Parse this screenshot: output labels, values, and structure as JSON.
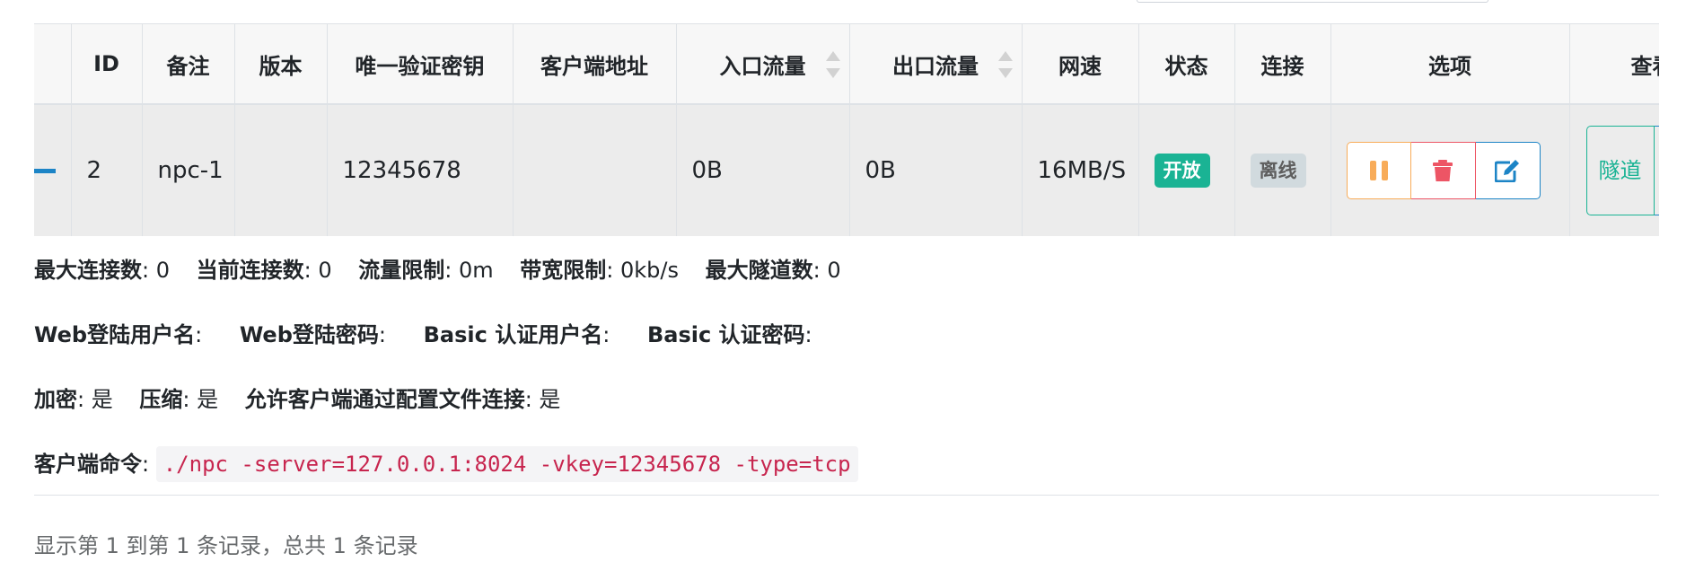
{
  "table": {
    "headers": {
      "id": "ID",
      "remark": "备注",
      "version": "版本",
      "vkey": "唯一验证密钥",
      "client_addr": "客户端地址",
      "in_flow": "入口流量",
      "out_flow": "出口流量",
      "speed": "网速",
      "status": "状态",
      "connection": "连接",
      "options": "选项",
      "view": "查看"
    },
    "row": {
      "id": "2",
      "remark": "npc-1",
      "version": "",
      "vkey": "12345678",
      "client_addr": "",
      "in_flow": "0B",
      "out_flow": "0B",
      "speed": "16MB/S",
      "status": "开放",
      "connection": "离线",
      "view_tunnel": "隧道"
    }
  },
  "details": {
    "max_conn_label": "最大连接数",
    "max_conn_value": ": 0",
    "cur_conn_label": "当前连接数",
    "cur_conn_value": ": 0",
    "flow_limit_label": "流量限制",
    "flow_limit_value": ": 0m",
    "bw_limit_label": "带宽限制",
    "bw_limit_value": ": 0kb/s",
    "max_tunnel_label": "最大隧道数",
    "max_tunnel_value": ": 0",
    "web_user_label": "Web登陆用户名",
    "web_user_value": ":",
    "web_pass_label": "Web登陆密码",
    "web_pass_value": ":",
    "basic_user_label": "Basic 认证用户名",
    "basic_user_value": ":",
    "basic_pass_label": "Basic 认证密码",
    "basic_pass_value": ":",
    "encrypt_label": "加密",
    "encrypt_value": ": 是",
    "compress_label": "压缩",
    "compress_value": ": 是",
    "config_conn_label": "允许客户端通过配置文件连接",
    "config_conn_value": ": 是",
    "cmd_label": "客户端命令",
    "cmd_colon": ":",
    "cmd_value": "./npc -server=127.0.0.1:8024 -vkey=12345678 -type=tcp"
  },
  "footer": {
    "info": "显示第 1 到第 1 条记录，总共 1 条记录"
  },
  "colors": {
    "status_open": "#1ab394",
    "status_offline": "#d1dade",
    "warning": "#f8ac59",
    "danger": "#ed5565",
    "info": "#1c84c6",
    "code_text": "#c7254e"
  },
  "icons": {
    "pause": "pause-icon",
    "delete": "trash-icon",
    "edit": "edit-icon"
  }
}
